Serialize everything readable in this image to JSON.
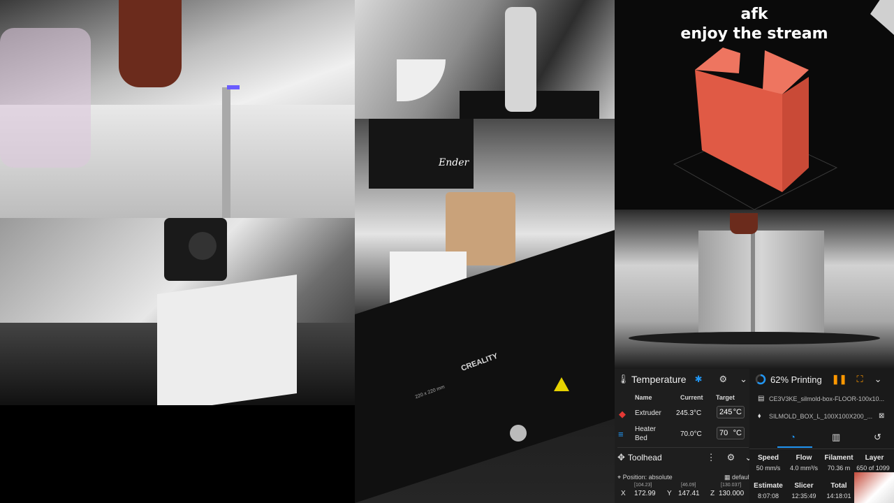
{
  "overlay": {
    "line1": "afk",
    "line2": "enjoy the stream"
  },
  "camera_labels": {
    "bed_size_text": "220 x 220 mm",
    "brand": "CREALITY",
    "extruder_brand": "Ender"
  },
  "temperature": {
    "title": "Temperature",
    "columns": {
      "name": "Name",
      "current": "Current",
      "target": "Target"
    },
    "rows": [
      {
        "name": "Extruder",
        "current": "245.3°C",
        "target": "245",
        "unit": "°C"
      },
      {
        "name": "Heater Bed",
        "current": "70.0°C",
        "target": "70",
        "unit": "°C"
      }
    ]
  },
  "toolhead": {
    "title": "Toolhead",
    "position_mode": "Position: absolute",
    "profile": "default",
    "axes": [
      {
        "axis": "X",
        "value": "172.99",
        "raw": "[104.23]"
      },
      {
        "axis": "Y",
        "value": "147.41",
        "raw": "[46.09]"
      },
      {
        "axis": "Z",
        "value": "130.000",
        "raw": "[130.037]"
      }
    ]
  },
  "status": {
    "progress_label": "62% Printing",
    "progress": 0.62,
    "files": [
      "CE3V3KE_silmold-box-FLOOR-100x10...",
      "SILMOLD_BOX_L_100X100X200_..."
    ],
    "stats": [
      {
        "label": "Speed",
        "value": "50 mm/s"
      },
      {
        "label": "Flow",
        "value": "4.0 mm³/s"
      },
      {
        "label": "Filament",
        "value": "70.36 m"
      },
      {
        "label": "Layer",
        "value": "650 of 1099"
      }
    ],
    "times": [
      {
        "label": "Estimate",
        "value": "8:07:08"
      },
      {
        "label": "Slicer",
        "value": "12:35:49"
      },
      {
        "label": "Total",
        "value": "14:18:01"
      }
    ]
  },
  "colors": {
    "accent": "#2196f3",
    "warning": "#ff9800",
    "model": "#e05a45",
    "panel": "#1e1e1e"
  }
}
